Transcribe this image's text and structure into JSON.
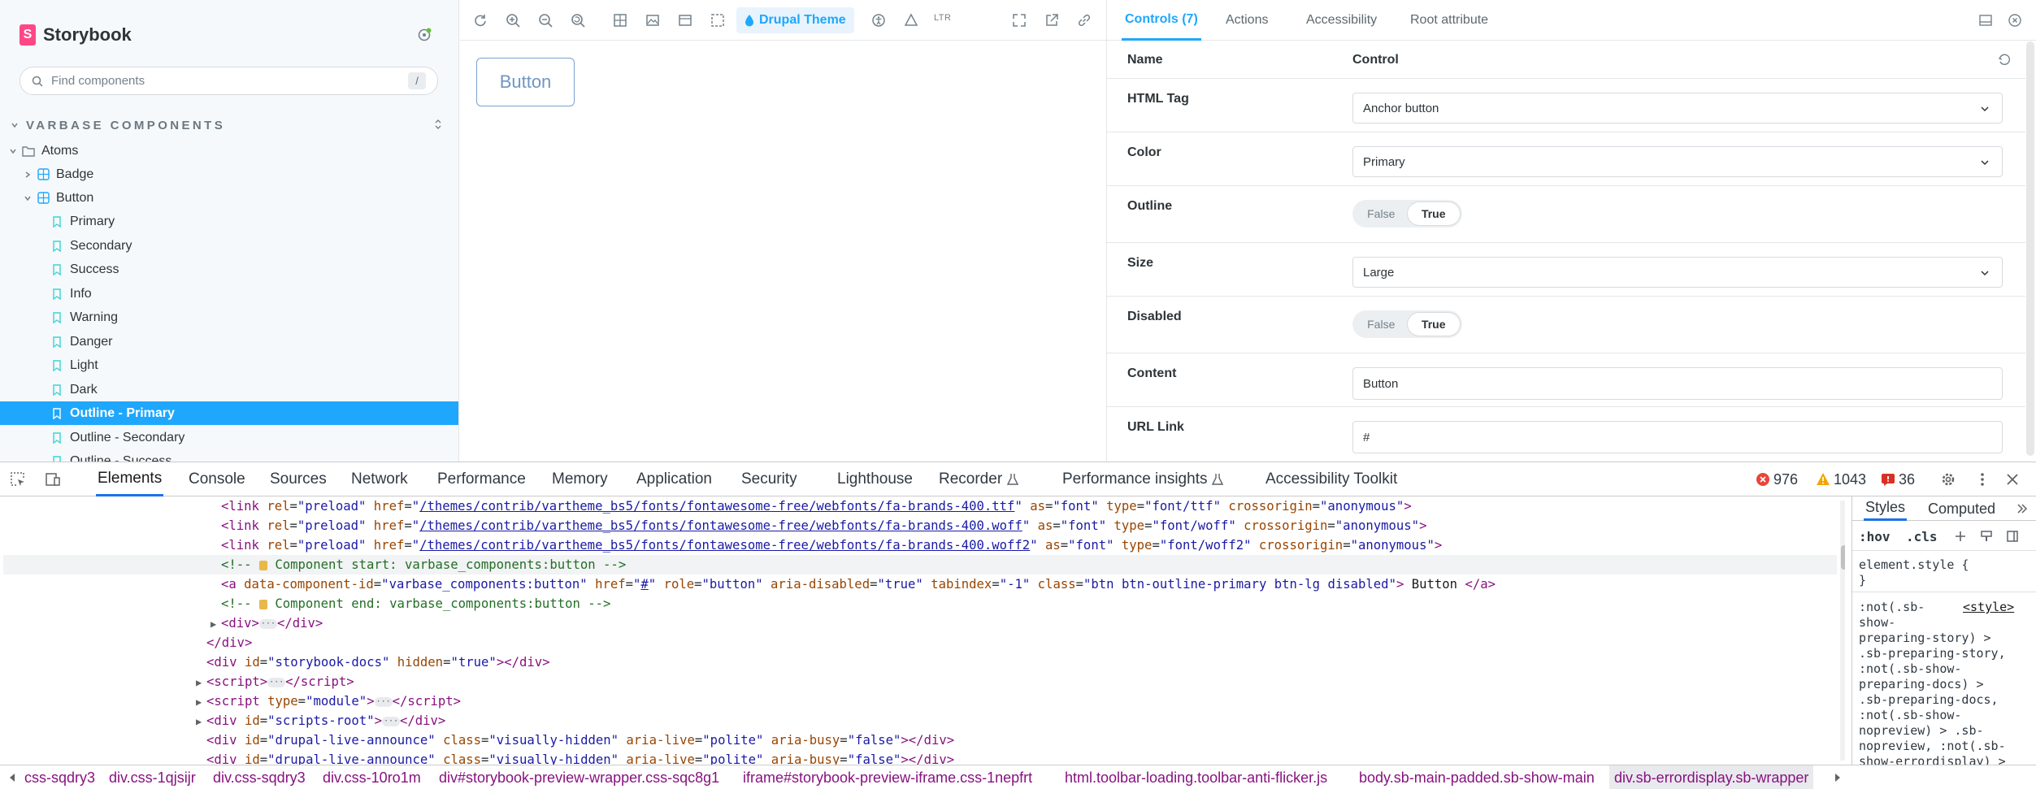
{
  "sidebar": {
    "brand": "Storybook",
    "search_placeholder": "Find components",
    "search_shortcut": "/",
    "section": "VARBASE COMPONENTS",
    "items": [
      {
        "label": "Atoms",
        "kind": "folder"
      },
      {
        "label": "Badge",
        "kind": "component"
      },
      {
        "label": "Button",
        "kind": "component"
      },
      {
        "label": "Primary",
        "kind": "story"
      },
      {
        "label": "Secondary",
        "kind": "story"
      },
      {
        "label": "Success",
        "kind": "story"
      },
      {
        "label": "Info",
        "kind": "story"
      },
      {
        "label": "Warning",
        "kind": "story"
      },
      {
        "label": "Danger",
        "kind": "story"
      },
      {
        "label": "Light",
        "kind": "story"
      },
      {
        "label": "Dark",
        "kind": "story"
      },
      {
        "label": "Outline - Primary",
        "kind": "story",
        "selected": true
      },
      {
        "label": "Outline - Secondary",
        "kind": "story"
      },
      {
        "label": "Outline - Success",
        "kind": "story"
      }
    ]
  },
  "toolbar": {
    "theme_label": "Drupal Theme",
    "direction_label": "LTR"
  },
  "preview": {
    "button_label": "Button"
  },
  "panel": {
    "tabs": [
      "Controls (7)",
      "Actions",
      "Accessibility",
      "Root attribute"
    ],
    "head_name": "Name",
    "head_control": "Control",
    "controls": [
      {
        "name": "HTML Tag",
        "type": "select",
        "value": "Anchor button"
      },
      {
        "name": "Color",
        "type": "select",
        "value": "Primary"
      },
      {
        "name": "Outline",
        "type": "toggle",
        "off": "False",
        "on": "True"
      },
      {
        "name": "Size",
        "type": "select",
        "value": "Large"
      },
      {
        "name": "Disabled",
        "type": "toggle",
        "off": "False",
        "on": "True"
      },
      {
        "name": "Content",
        "type": "text",
        "value": "Button"
      },
      {
        "name": "URL Link",
        "type": "text",
        "value": "#"
      }
    ]
  },
  "devtools": {
    "tabs": [
      "Elements",
      "Console",
      "Sources",
      "Network",
      "Performance",
      "Memory",
      "Application",
      "Security",
      "Lighthouse",
      "Recorder",
      "Performance insights",
      "Accessibility Toolkit"
    ],
    "errors": "976",
    "warnings": "1043",
    "issues": "36",
    "code": {
      "l1_href": "/themes/contrib/vartheme_bs5/fonts/fontawesome-free/webfonts/fa-brands-400.ttf",
      "l1_type": "font/ttf",
      "l2_href": "/themes/contrib/vartheme_bs5/fonts/fontawesome-free/webfonts/fa-brands-400.woff",
      "l2_type": "font/woff",
      "l3_href": "/themes/contrib/vartheme_bs5/fonts/fontawesome-free/webfonts/fa-brands-400.woff2",
      "l3_type": "font/woff2",
      "comment_start": " Component start: varbase_components:button ",
      "comment_end": " Component end: varbase_components:button ",
      "a_component_id": "varbase_components:button",
      "a_href": "#",
      "a_class": "btn btn-outline-primary btn-lg disabled",
      "a_text": " Button ",
      "docs_id": "storybook-docs",
      "script_type": "module",
      "scripts_root": "scripts-root",
      "live_id": "drupal-live-announce",
      "live_class": "visually-hidden"
    },
    "styles_tabs": [
      "Styles",
      "Computed"
    ],
    "styles_filter": [
      ":hov",
      ".cls"
    ],
    "styles_source": "<style>",
    "styles_lines": [
      "element.style {",
      "}",
      ":not(.sb-",
      "show-",
      "preparing-story) >",
      ".sb-preparing-story,",
      ":not(.sb-show-",
      "preparing-docs) >",
      ".sb-preparing-docs,",
      ":not(.sb-show-",
      "nopreview) > .sb-",
      "nopreview, :not(.sb-",
      "show-errordisplay) >",
      ".sb-errordisplay {"
    ],
    "breadcrumbs": [
      "css-sqdry3",
      "div.css-1qjsijr",
      "div.css-sqdry3",
      "div.css-10ro1m",
      "div#storybook-preview-wrapper.css-sqc8g1",
      "iframe#storybook-preview-iframe.css-1nepfrt",
      "html.toolbar-loading.toolbar-anti-flicker.js",
      "body.sb-main-padded.sb-show-main",
      "div.sb-errordisplay.sb-wrapper"
    ]
  }
}
